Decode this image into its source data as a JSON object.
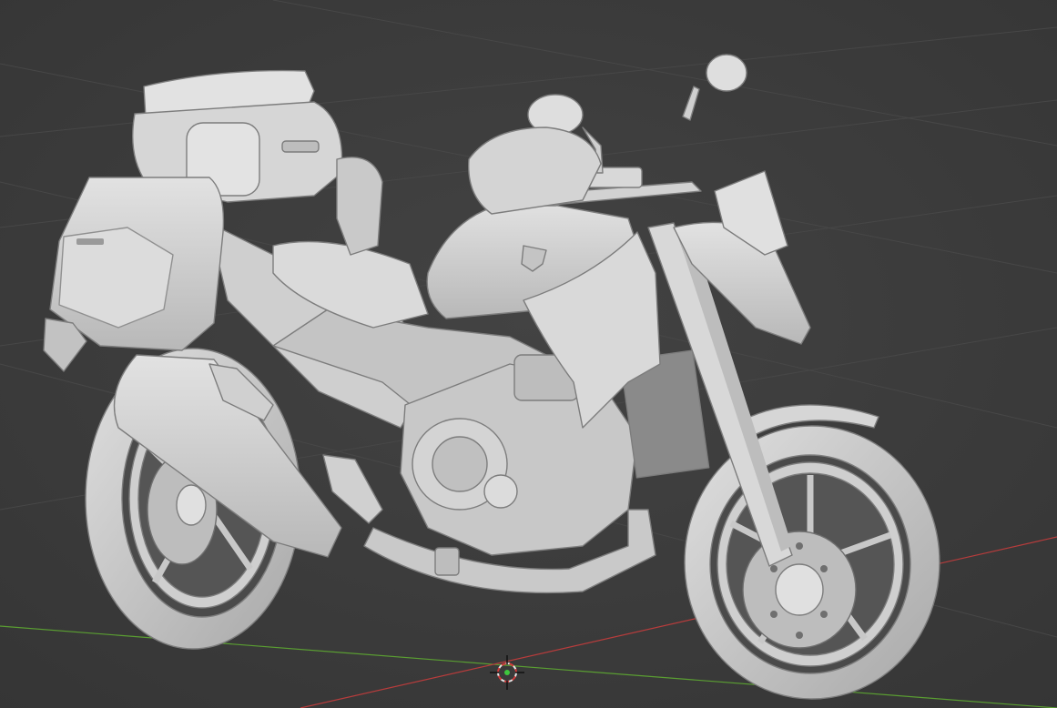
{
  "viewport": {
    "background_color": "#3d3d3d",
    "grid_line_color": "#444444",
    "x_axis_color": "#b83c3c",
    "y_axis_color": "#5a9e32",
    "object_color": "#d2d2d2",
    "object_shadow_color": "#a9a9a9",
    "object_outline_color": "#7d7d7d",
    "cursor_icon": "3d-cursor-icon",
    "object": "motorcycle-model"
  }
}
